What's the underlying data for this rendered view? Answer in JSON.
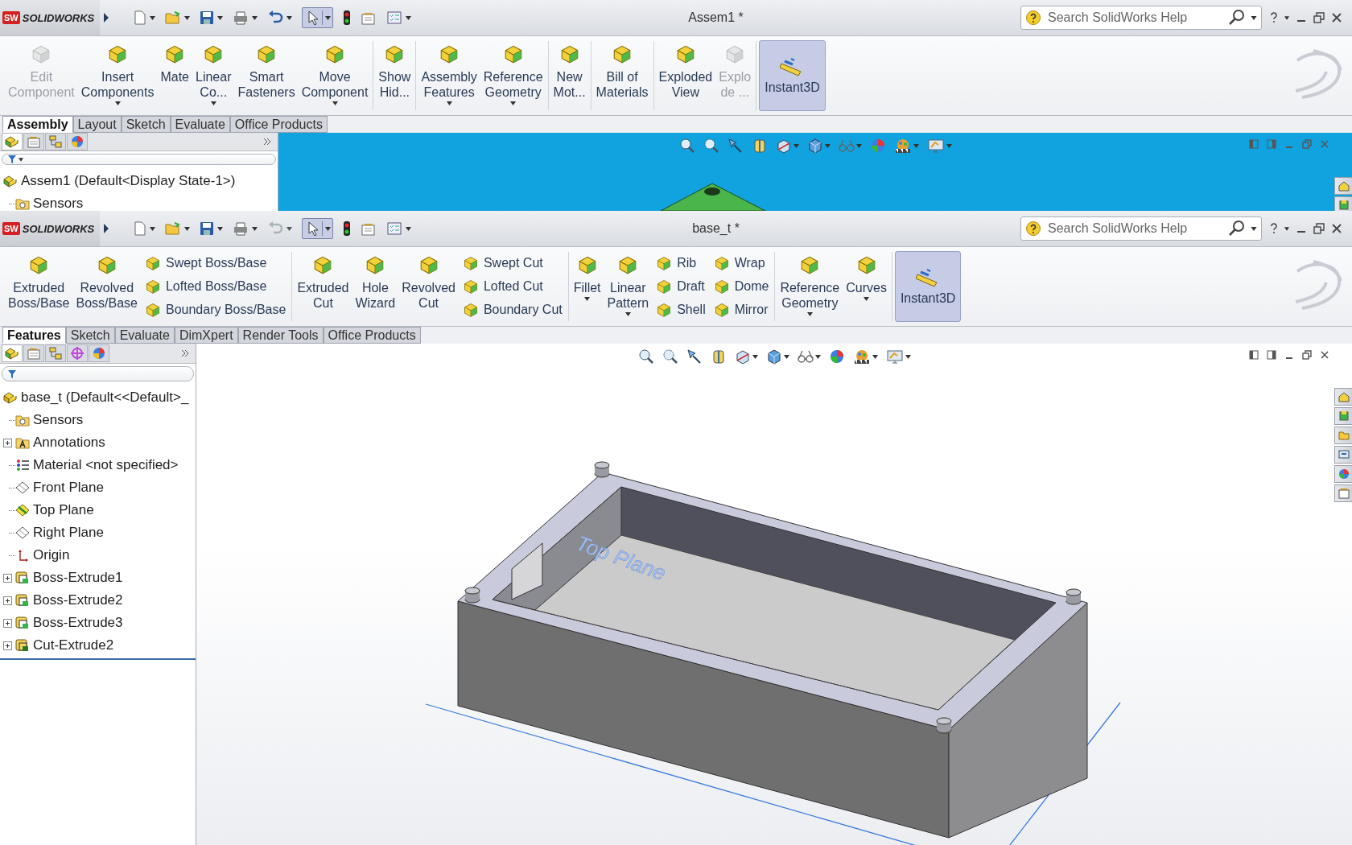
{
  "windows": [
    {
      "logo_mark": "SW",
      "app_name": "SOLIDWORKS",
      "title": "Assem1 *",
      "search": {
        "placeholder": "Search SolidWorks Help"
      },
      "ribbon": [
        [
          {
            "kind": "large",
            "label": "Edit\nComponent",
            "disabled": true,
            "dropdown": false
          },
          {
            "kind": "large",
            "label": "Insert\nComponents",
            "disabled": false,
            "dropdown": true
          },
          {
            "kind": "large",
            "label": "Mate",
            "disabled": false,
            "dropdown": false
          },
          {
            "kind": "large",
            "label": "Linear\nCo...",
            "disabled": false,
            "dropdown": true
          },
          {
            "kind": "large",
            "label": "Smart\nFasteners",
            "disabled": false,
            "dropdown": false
          },
          {
            "kind": "large",
            "label": "Move\nComponent",
            "disabled": false,
            "dropdown": true
          }
        ],
        [
          {
            "kind": "large",
            "label": "Show\nHid...",
            "disabled": false,
            "dropdown": false
          }
        ],
        [
          {
            "kind": "large",
            "label": "Assembly\nFeatures",
            "disabled": false,
            "dropdown": true
          },
          {
            "kind": "large",
            "label": "Reference\nGeometry",
            "disabled": false,
            "dropdown": true
          }
        ],
        [
          {
            "kind": "large",
            "label": "New\nMot...",
            "disabled": false,
            "dropdown": false
          }
        ],
        [
          {
            "kind": "large",
            "label": "Bill of\nMaterials",
            "disabled": false,
            "dropdown": false
          }
        ],
        [
          {
            "kind": "large",
            "label": "Exploded\nView",
            "disabled": false,
            "dropdown": false
          },
          {
            "kind": "large",
            "label": "Explo\nde ...",
            "disabled": true,
            "dropdown": false
          }
        ],
        [
          {
            "kind": "toggle",
            "label": "Instant3D",
            "on": true
          }
        ]
      ],
      "tabs": [
        {
          "label": "Assembly",
          "selected": true
        },
        {
          "label": "Layout",
          "selected": false
        },
        {
          "label": "Sketch",
          "selected": false
        },
        {
          "label": "Evaluate",
          "selected": false
        },
        {
          "label": "Office Products",
          "selected": false
        }
      ],
      "panel_tabs": [
        {
          "selected": true
        },
        {
          "selected": false
        },
        {
          "selected": false
        },
        {
          "selected": false
        }
      ],
      "tree": {
        "kind": "assembly",
        "label": "Assem1  (Default<Display State-1>)",
        "children": [
          {
            "kind": "folder",
            "label": "Sensors",
            "expandable": false
          }
        ]
      },
      "viewport": {
        "kind": "assembly"
      }
    },
    {
      "logo_mark": "SW",
      "app_name": "SOLIDWORKS",
      "title": "base_t *",
      "search": {
        "placeholder": "Search SolidWorks Help"
      },
      "ribbon": [
        [
          {
            "kind": "large",
            "label": "Extruded\nBoss/Base",
            "disabled": false,
            "dropdown": false
          },
          {
            "kind": "large",
            "label": "Revolved\nBoss/Base",
            "disabled": false,
            "dropdown": false
          },
          {
            "kind": "stack",
            "items": [
              {
                "label": "Swept Boss/Base"
              },
              {
                "label": "Lofted Boss/Base"
              },
              {
                "label": "Boundary Boss/Base"
              }
            ]
          }
        ],
        [
          {
            "kind": "large",
            "label": "Extruded\nCut",
            "disabled": false,
            "dropdown": false
          },
          {
            "kind": "large",
            "label": "Hole\nWizard",
            "disabled": false,
            "dropdown": false
          },
          {
            "kind": "large",
            "label": "Revolved\nCut",
            "disabled": false,
            "dropdown": false
          },
          {
            "kind": "stack",
            "items": [
              {
                "label": "Swept Cut"
              },
              {
                "label": "Lofted Cut"
              },
              {
                "label": "Boundary Cut"
              }
            ]
          }
        ],
        [
          {
            "kind": "large",
            "label": "Fillet",
            "disabled": false,
            "dropdown": true
          },
          {
            "kind": "large",
            "label": "Linear\nPattern",
            "disabled": false,
            "dropdown": true
          },
          {
            "kind": "stack",
            "items": [
              {
                "label": "Rib"
              },
              {
                "label": "Draft"
              },
              {
                "label": "Shell"
              }
            ]
          },
          {
            "kind": "stack",
            "items": [
              {
                "label": "Wrap"
              },
              {
                "label": "Dome"
              },
              {
                "label": "Mirror"
              }
            ]
          }
        ],
        [
          {
            "kind": "large",
            "label": "Reference\nGeometry",
            "disabled": false,
            "dropdown": true
          },
          {
            "kind": "large",
            "label": "Curves",
            "disabled": false,
            "dropdown": true
          }
        ],
        [
          {
            "kind": "toggle",
            "label": "Instant3D",
            "on": true
          }
        ]
      ],
      "tabs": [
        {
          "label": "Features",
          "selected": true
        },
        {
          "label": "Sketch",
          "selected": false
        },
        {
          "label": "Evaluate",
          "selected": false
        },
        {
          "label": "DimXpert",
          "selected": false
        },
        {
          "label": "Render Tools",
          "selected": false
        },
        {
          "label": "Office Products",
          "selected": false
        }
      ],
      "panel_tabs": [
        {
          "selected": true
        },
        {
          "selected": false
        },
        {
          "selected": false
        },
        {
          "selected": false
        },
        {
          "selected": false
        }
      ],
      "tree": {
        "kind": "part",
        "label": "base_t  (Default<<Default>_",
        "children": [
          {
            "kind": "folder",
            "label": "Sensors",
            "expandable": false
          },
          {
            "kind": "annotations",
            "label": "Annotations",
            "expandable": true
          },
          {
            "kind": "material",
            "label": "Material <not specified>",
            "expandable": false
          },
          {
            "kind": "plane",
            "label": "Front Plane",
            "expandable": false,
            "shown": false
          },
          {
            "kind": "plane",
            "label": "Top Plane",
            "expandable": false,
            "shown": true
          },
          {
            "kind": "plane",
            "label": "Right Plane",
            "expandable": false,
            "shown": false
          },
          {
            "kind": "origin",
            "label": "Origin",
            "expandable": false
          },
          {
            "kind": "feature",
            "label": "Boss-Extrude1",
            "expandable": true
          },
          {
            "kind": "feature",
            "label": "Boss-Extrude2",
            "expandable": true
          },
          {
            "kind": "feature",
            "label": "Boss-Extrude3",
            "expandable": true
          },
          {
            "kind": "cut",
            "label": "Cut-Extrude2",
            "expandable": true
          }
        ]
      },
      "viewport": {
        "kind": "part",
        "plane_label": "Top Plane"
      }
    }
  ]
}
